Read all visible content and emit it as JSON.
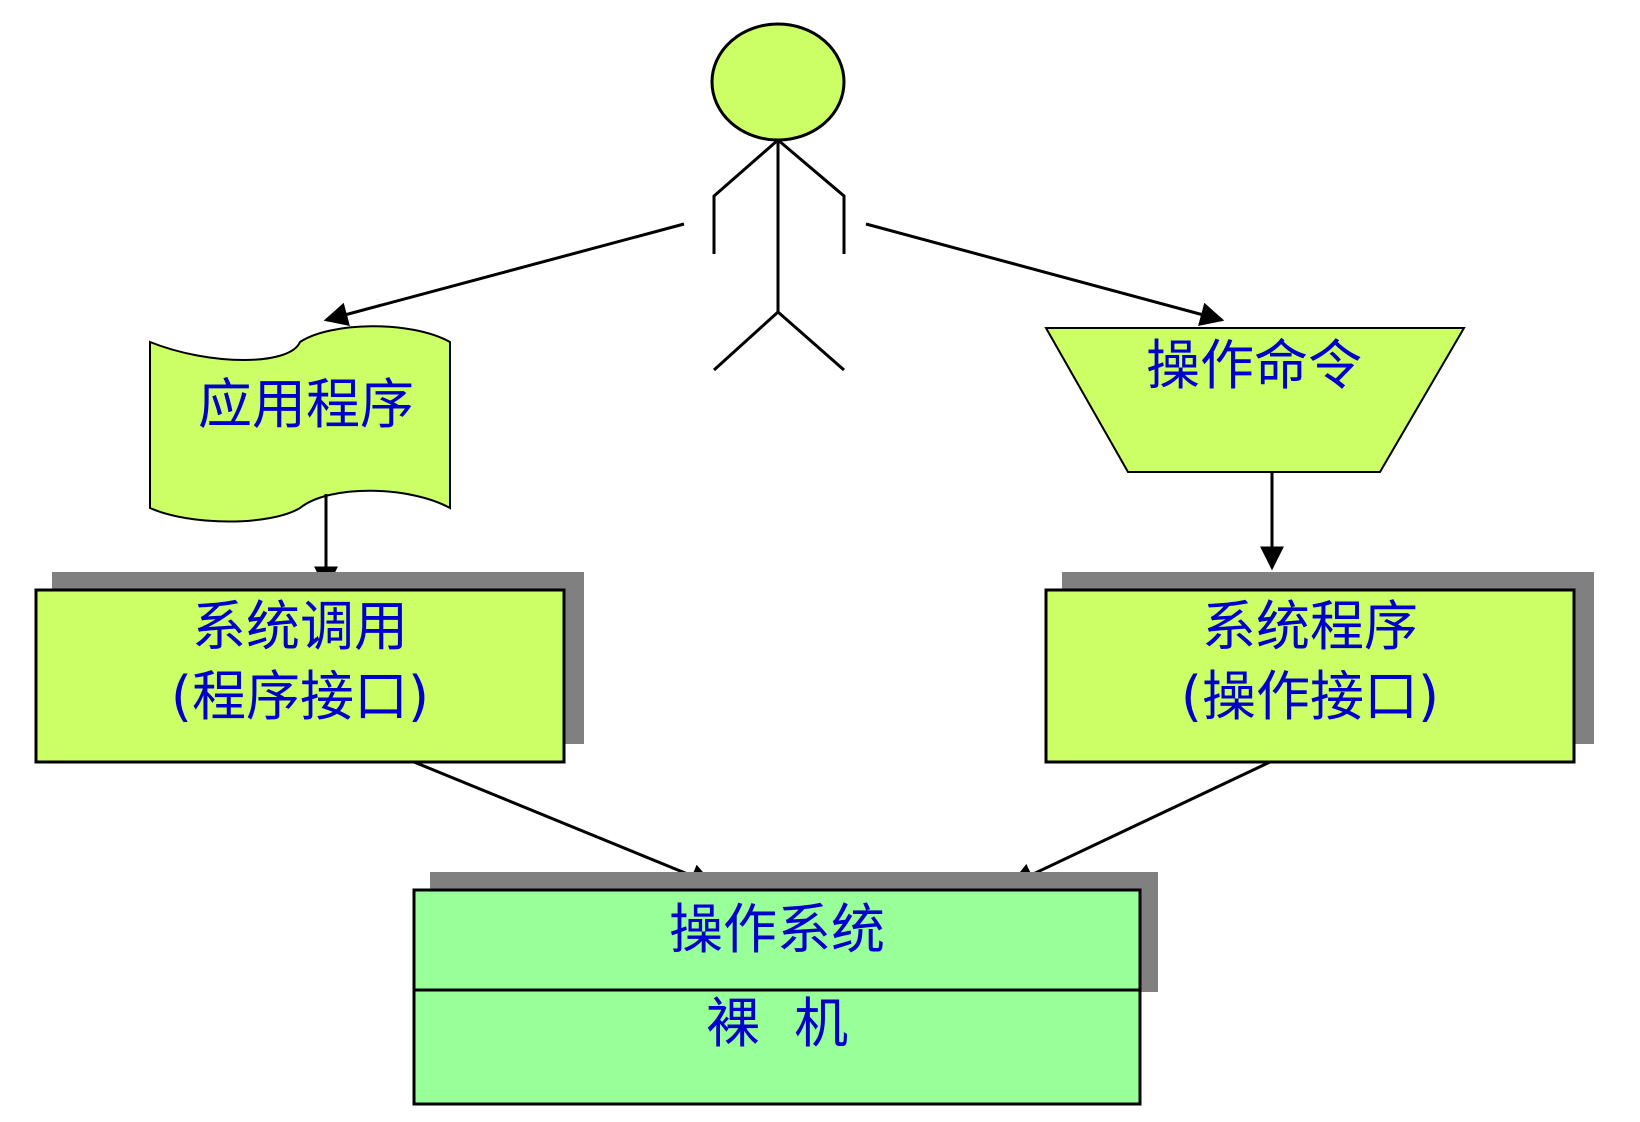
{
  "colors": {
    "lime_fill": "#ccff66",
    "green_fill": "#99ff99",
    "shadow": "#808080",
    "text": "#0000cc",
    "stroke": "#000000"
  },
  "nodes": {
    "app_program": "应用程序",
    "operation_command": "操作命令",
    "system_call": {
      "line1": "系统调用",
      "line2": "(程序接口)"
    },
    "system_program": {
      "line1": "系统程序",
      "line2": "(操作接口)"
    },
    "operating_system": "操作系统",
    "bare_machine": "裸  机"
  }
}
